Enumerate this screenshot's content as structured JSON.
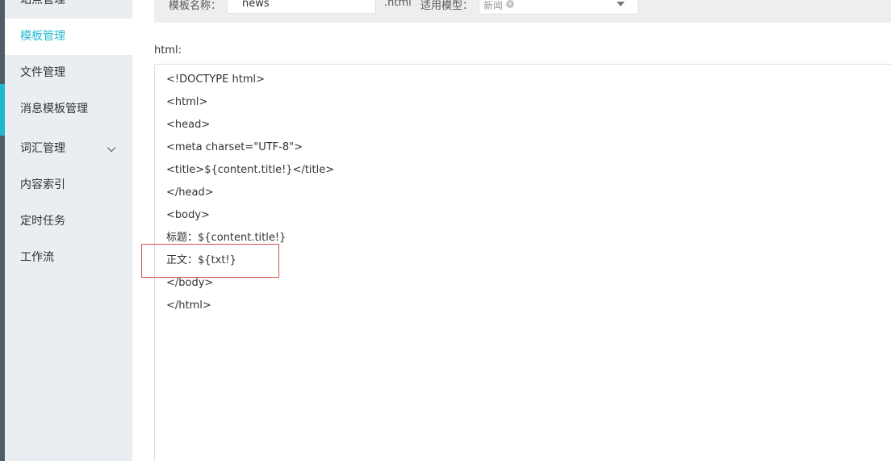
{
  "sidebar": {
    "items": [
      {
        "label": "站点管理"
      },
      {
        "label": "模板管理",
        "active": true
      },
      {
        "label": "文件管理"
      },
      {
        "label": "消息模板管理"
      },
      {
        "label": "词汇管理",
        "icon": "chevron-down-icon"
      },
      {
        "label": "内容索引"
      },
      {
        "label": "定时任务"
      },
      {
        "label": "工作流"
      }
    ]
  },
  "form": {
    "template_name_label": "模板名称：",
    "template_name_value": "news",
    "suffix": ".html",
    "model_label": "适用模型：",
    "model_tag": "新闻",
    "model_tag_remove_icon": "close-icon",
    "model_dropdown_icon": "caret-down-icon"
  },
  "editor": {
    "label": "html:",
    "lines": [
      "<!DOCTYPE html>",
      "<html>",
      "<head>",
      "<meta charset=\"UTF-8\">",
      "<title>${content.title!}</title>",
      "</head>",
      "<body>",
      "标题：${content.title!}",
      "正文：${txt!}",
      "</body>",
      "</html>"
    ]
  },
  "colors": {
    "accent": "#1fb8d0",
    "sidebar_bg": "#eaedf1",
    "rail": "#4f5d6b",
    "highlight_border": "#d9534f"
  }
}
